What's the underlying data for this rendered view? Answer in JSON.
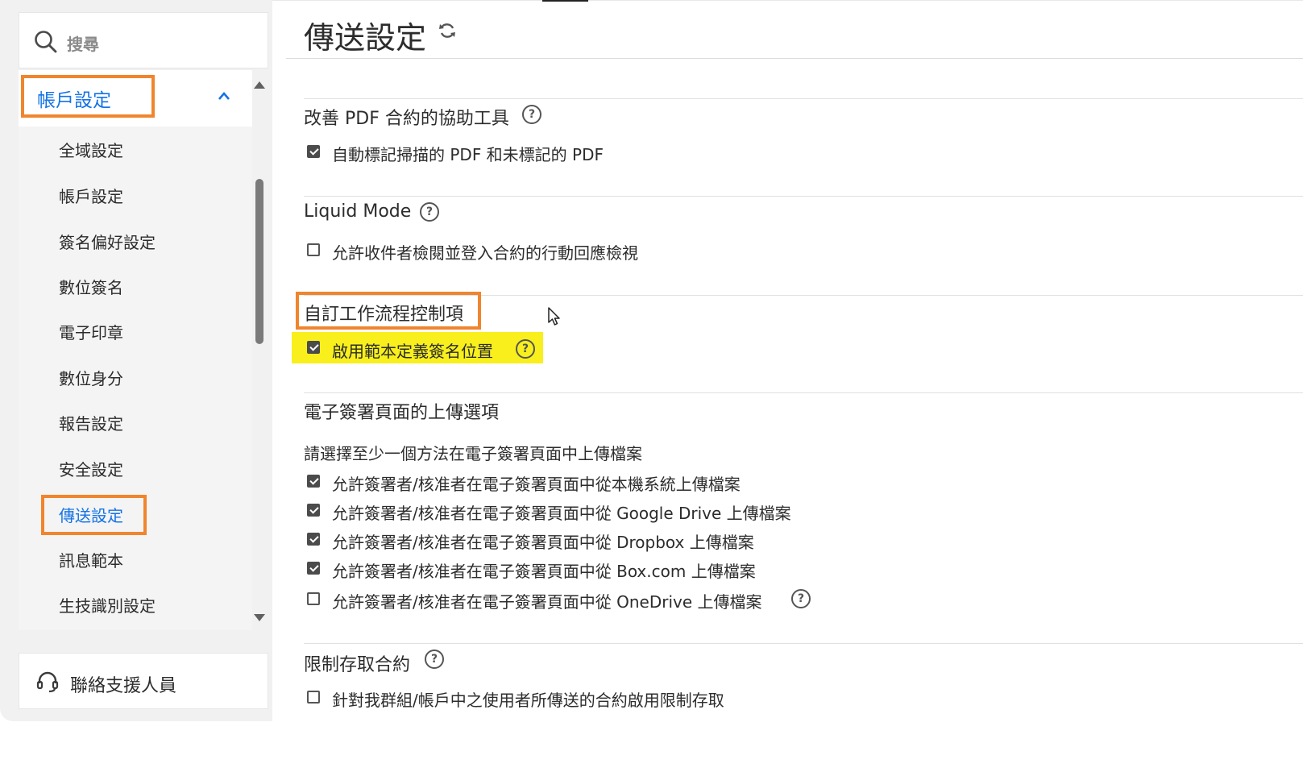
{
  "sidebar": {
    "search_placeholder": "搜尋",
    "section_header": "帳戶設定",
    "items": [
      {
        "label": "全域設定"
      },
      {
        "label": "帳戶設定"
      },
      {
        "label": "簽名偏好設定"
      },
      {
        "label": "數位簽名"
      },
      {
        "label": "電子印章"
      },
      {
        "label": "數位身分"
      },
      {
        "label": "報告設定"
      },
      {
        "label": "安全設定"
      },
      {
        "label": "傳送設定",
        "active": true
      },
      {
        "label": "訊息範本"
      },
      {
        "label": "生技識別設定"
      }
    ],
    "support_label": "聯絡支援人員"
  },
  "main": {
    "title": "傳送設定",
    "sections": [
      {
        "title": "改善 PDF 合約的協助工具",
        "options": [
          {
            "label": "自動標記掃描的 PDF 和未標記的 PDF",
            "checked": true
          }
        ]
      },
      {
        "title": "Liquid Mode",
        "options": [
          {
            "label": "允許收件者檢閱並登入合約的行動回應檢視",
            "checked": false
          }
        ]
      },
      {
        "title": "自訂工作流程控制項",
        "options": [
          {
            "label": "啟用範本定義簽名位置",
            "checked": true
          }
        ]
      },
      {
        "title": "電子簽署頁面的上傳選項",
        "subtitle": "請選擇至少一個方法在電子簽署頁面中上傳檔案",
        "options": [
          {
            "label": "允許簽署者/核准者在電子簽署頁面中從本機系統上傳檔案",
            "checked": true
          },
          {
            "label": "允許簽署者/核准者在電子簽署頁面中從 Google Drive 上傳檔案",
            "checked": true
          },
          {
            "label": "允許簽署者/核准者在電子簽署頁面中從 Dropbox 上傳檔案",
            "checked": true
          },
          {
            "label": "允許簽署者/核准者在電子簽署頁面中從 Box.com 上傳檔案",
            "checked": true
          },
          {
            "label": "允許簽署者/核准者在電子簽署頁面中從 OneDrive 上傳檔案",
            "checked": false
          }
        ]
      },
      {
        "title": "限制存取合約",
        "options": [
          {
            "label": "針對我群組/帳戶中之使用者所傳送的合約啟用限制存取",
            "checked": false
          }
        ]
      }
    ]
  },
  "colors": {
    "accent": "#1473e6",
    "highlight_box": "#f0852d",
    "yellow_highlight": "#f8ef1c"
  },
  "icons": {
    "search": "search-icon",
    "chevron": "chevron-up-icon",
    "refresh": "refresh-icon",
    "help": "help-circle-icon",
    "support": "headset-icon",
    "cursor": "mouse-pointer-icon"
  }
}
